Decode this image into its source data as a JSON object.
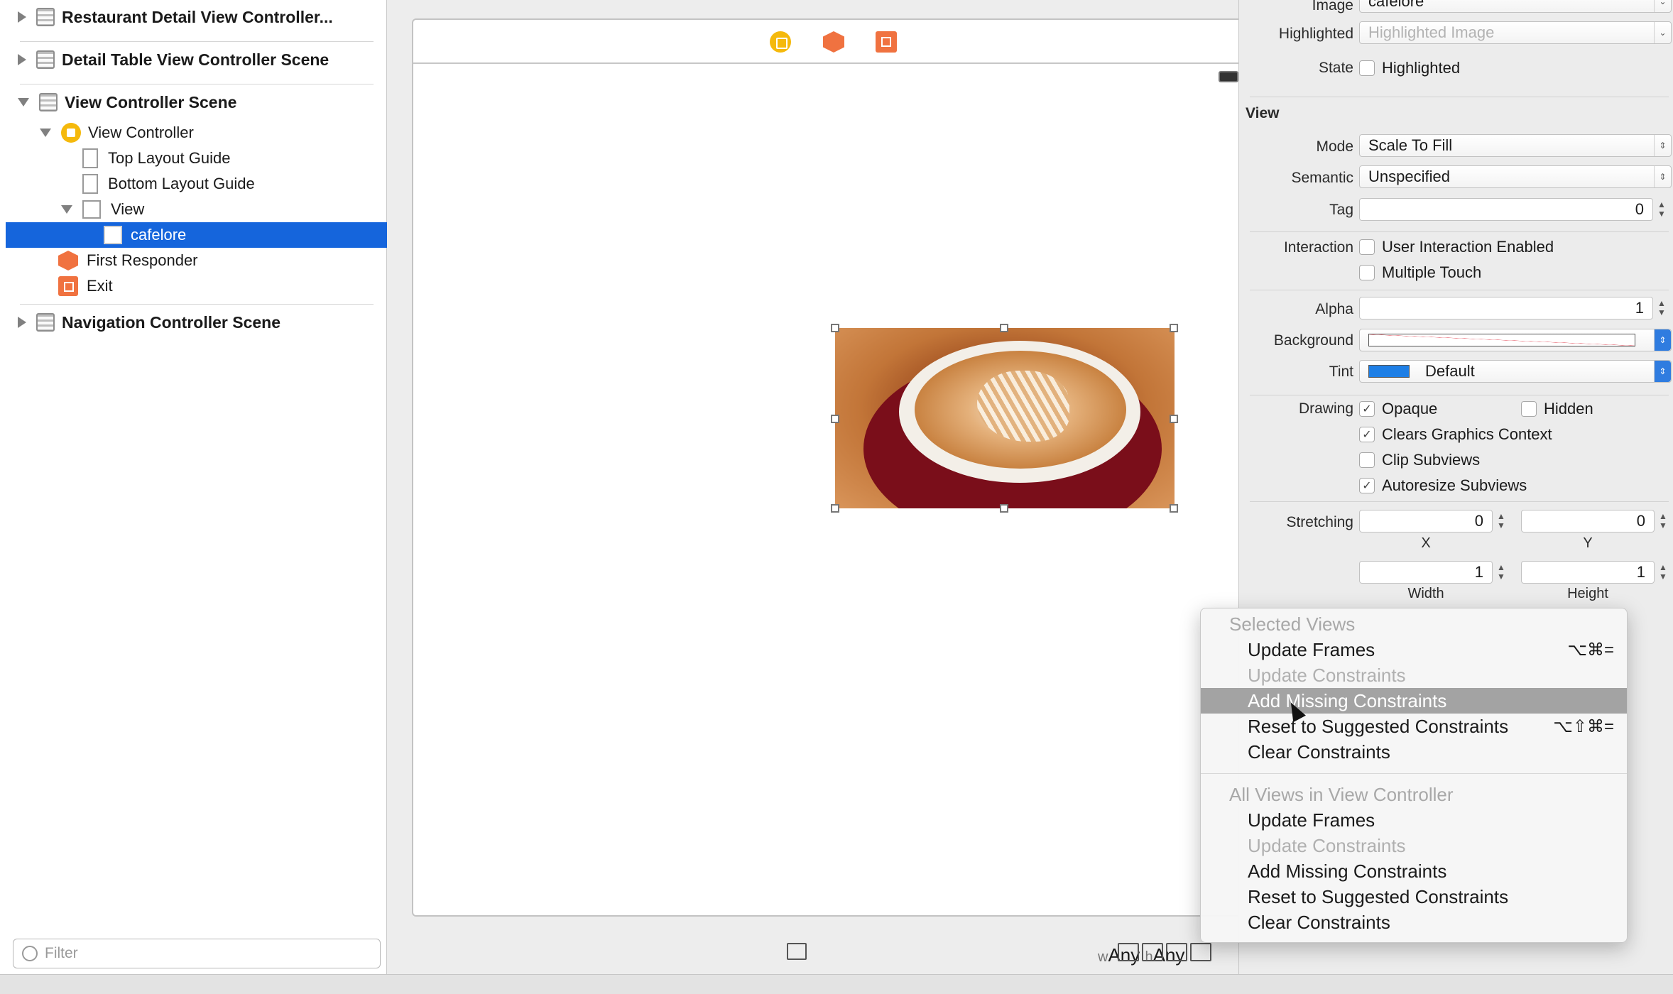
{
  "outline": {
    "scenes": [
      {
        "title": "Restaurant Detail View Controller...",
        "expanded": false
      },
      {
        "title": "Detail Table View Controller Scene",
        "expanded": false
      },
      {
        "title": "View Controller Scene",
        "expanded": true
      },
      {
        "title": "Navigation Controller Scene",
        "expanded": false
      }
    ],
    "tree": {
      "view_controller": "View Controller",
      "top_layout_guide": "Top Layout Guide",
      "bottom_layout_guide": "Bottom Layout Guide",
      "view": "View",
      "selected_image_view": "cafelore",
      "first_responder": "First Responder",
      "exit": "Exit"
    },
    "filter_placeholder": "Filter"
  },
  "canvas": {
    "size_class": {
      "w_prefix": "w",
      "w_value": "Any",
      "h_prefix": "h",
      "h_value": "Any"
    },
    "selected_image": "cafelore"
  },
  "inspector": {
    "image": {
      "label": "Image",
      "value": "cafelore"
    },
    "highlighted": {
      "label": "Highlighted",
      "placeholder": "Highlighted Image"
    },
    "state": {
      "label": "State",
      "checkbox_label": "Highlighted",
      "checked": false
    },
    "view_section_title": "View",
    "mode": {
      "label": "Mode",
      "value": "Scale To Fill"
    },
    "semantic": {
      "label": "Semantic",
      "value": "Unspecified"
    },
    "tag": {
      "label": "Tag",
      "value": "0"
    },
    "interaction": {
      "label": "Interaction",
      "user_interaction_enabled": {
        "label": "User Interaction Enabled",
        "checked": false
      },
      "multiple_touch": {
        "label": "Multiple Touch",
        "checked": false
      }
    },
    "alpha": {
      "label": "Alpha",
      "value": "1"
    },
    "background": {
      "label": "Background"
    },
    "tint": {
      "label": "Tint",
      "value": "Default",
      "color": "#1e7fe6"
    },
    "drawing": {
      "label": "Drawing",
      "opaque": {
        "label": "Opaque",
        "checked": true
      },
      "hidden": {
        "label": "Hidden",
        "checked": false
      },
      "clears_graphics_context": {
        "label": "Clears Graphics Context",
        "checked": true
      },
      "clip_subviews": {
        "label": "Clip Subviews",
        "checked": false
      },
      "autoresize_subviews": {
        "label": "Autoresize Subviews",
        "checked": true
      }
    },
    "stretching": {
      "label": "Stretching",
      "x": {
        "label": "X",
        "value": "0"
      },
      "y": {
        "label": "Y",
        "value": "0"
      },
      "width": {
        "label": "Width",
        "value": "1"
      },
      "height": {
        "label": "Height",
        "value": "1"
      }
    }
  },
  "resolve_menu": {
    "selected_views_header": "Selected Views",
    "selected_items": [
      {
        "label": "Update Frames",
        "shortcut": "⌥⌘=",
        "enabled": true
      },
      {
        "label": "Update Constraints",
        "shortcut": "",
        "enabled": false
      },
      {
        "label": "Add Missing Constraints",
        "shortcut": "",
        "enabled": true,
        "highlighted": true
      },
      {
        "label": "Reset to Suggested Constraints",
        "shortcut": "⌥⇧⌘=",
        "enabled": true
      },
      {
        "label": "Clear Constraints",
        "shortcut": "",
        "enabled": true
      }
    ],
    "all_views_header": "All Views in View Controller",
    "all_items": [
      {
        "label": "Update Frames",
        "enabled": true
      },
      {
        "label": "Update Constraints",
        "enabled": false
      },
      {
        "label": "Add Missing Constraints",
        "enabled": true
      },
      {
        "label": "Reset to Suggested Constraints",
        "enabled": true
      },
      {
        "label": "Clear Constraints",
        "enabled": true
      }
    ]
  }
}
